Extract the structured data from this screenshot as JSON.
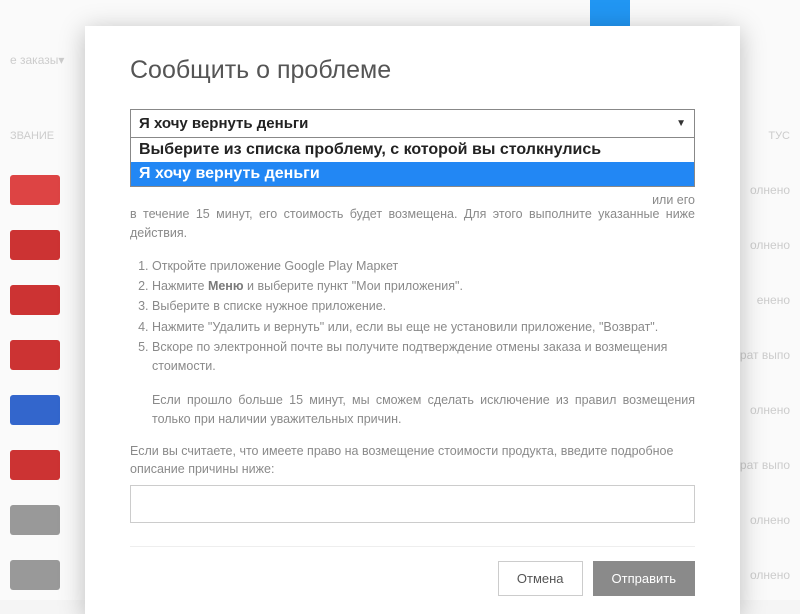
{
  "background": {
    "header_name": "ЗВАНИЕ",
    "header_status": "ТУС",
    "orders_label": "е заказы",
    "status_done": "олнено",
    "status_done2": "енено",
    "status_refund": "рат выпо"
  },
  "modal": {
    "title": "Сообщить о проблеме",
    "select": {
      "selected": "Я хочу вернуть деньги",
      "options": [
        "Выберите из списка проблему, с которой вы столкнулись",
        "Я хочу вернуть деньги"
      ]
    },
    "purchase_note": "в течение 15 минут, его стоимость будет возмещена. Для этого выполните указанные ниже действия.",
    "purchase_note_tail": "или его",
    "instructions": [
      "Откройте приложение Google Play Маркет",
      "Нажмите <b>Меню</b> и выберите пункт \"Мои приложения\".",
      "Выберите в списке нужное приложение.",
      "Нажмите \"Удалить и вернуть\" или, если вы еще не установили приложение, \"Возврат\".",
      "Вскоре по электронной почте вы получите подтверждение отмены заказа и возмещения стоимости."
    ],
    "extra_note": "Если прошло больше 15 минут, мы сможем сделать исключение из правил возмещения только при наличии уважительных причин.",
    "describe_label": "Если вы считаете, что имеете право на возмещение стоимости продукта, введите подробное описание причины ниже:",
    "cancel": "Отмена",
    "submit": "Отправить"
  }
}
